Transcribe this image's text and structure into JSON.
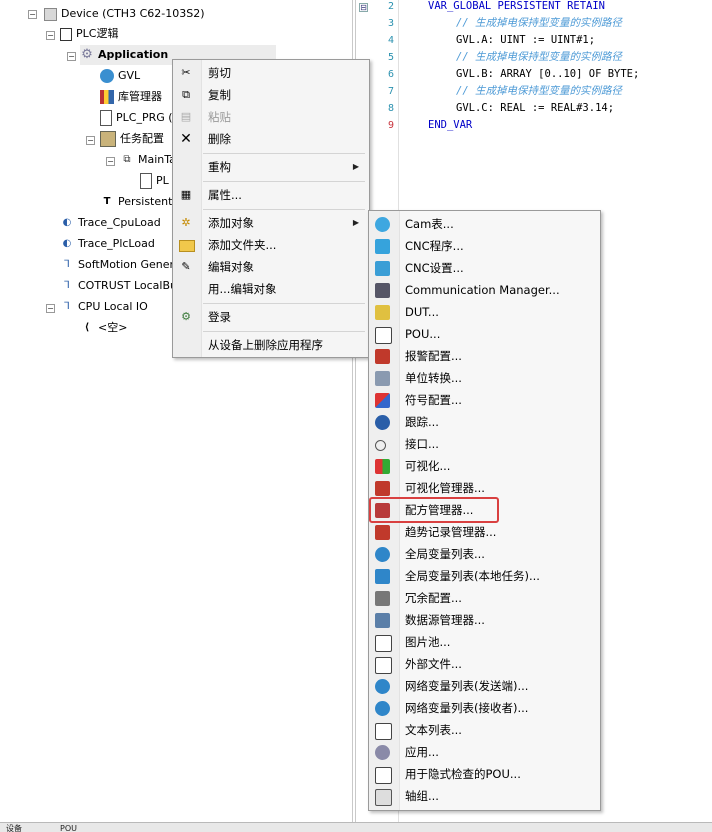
{
  "tree": {
    "device": "Device (CTH3 C62-103S2)",
    "plc_logic": "PLC逻辑",
    "application": "Application",
    "gvl": "GVL",
    "library_manager": "库管理器",
    "plc_prg": "PLC_PRG (",
    "task_config": "任务配置",
    "main_task": "MainTa",
    "pl": "PL",
    "persistent": "Persistent",
    "trace_cpuload": "Trace_CpuLoad",
    "trace_plcload": "Trace_PlcLoad",
    "softmotion": "SoftMotion Genera",
    "cotrust": "COTRUST LocalBus",
    "cpu_local_io": "CPU Local IO",
    "empty": "<空>"
  },
  "code": {
    "lines": [
      {
        "n": "2",
        "text": "VAR_GLOBAL PERSISTENT RETAIN"
      },
      {
        "n": "3",
        "text": "// 生成掉电保持型变量的实例路径"
      },
      {
        "n": "4",
        "text": "GVL.A: UINT := UINT#1;"
      },
      {
        "n": "5",
        "text": "// 生成掉电保持型变量的实例路径"
      },
      {
        "n": "6",
        "text": "GVL.B: ARRAY [0..10] OF BYTE;"
      },
      {
        "n": "7",
        "text": "// 生成掉电保持型变量的实例路径"
      },
      {
        "n": "8",
        "text": "GVL.C: REAL := REAL#3.14;"
      },
      {
        "n": "9",
        "text": "END_VAR"
      }
    ]
  },
  "context_menu": {
    "cut": "剪切",
    "copy": "复制",
    "paste": "粘贴",
    "delete": "删除",
    "refactor": "重构",
    "properties": "属性...",
    "add_object": "添加对象",
    "add_folder": "添加文件夹...",
    "edit_object": "编辑对象",
    "edit_object_with": "用...编辑对象",
    "login": "登录",
    "remove_app": "从设备上删除应用程序"
  },
  "submenu": {
    "items": [
      "Cam表...",
      "CNC程序...",
      "CNC设置...",
      "Communication Manager...",
      "DUT...",
      "POU...",
      "报警配置...",
      "单位转换...",
      "符号配置...",
      "跟踪...",
      "接口...",
      "可视化...",
      "可视化管理器...",
      "配方管理器...",
      "趋势记录管理器...",
      "全局变量列表...",
      "全局变量列表(本地任务)...",
      "冗余配置...",
      "数据源管理器...",
      "图片池...",
      "外部文件...",
      "网络变量列表(发送端)...",
      "网络变量列表(接收者)...",
      "文本列表...",
      "应用...",
      "用于隐式检查的POU...",
      "轴组..."
    ],
    "highlighted": "配方管理器..."
  },
  "bottom_tabs": {
    "devices": "设备",
    "pou": "POU"
  },
  "colors": {
    "keyword": "#0000c8",
    "comment": "#4d9ad6",
    "highlight_box": "#d94040"
  }
}
